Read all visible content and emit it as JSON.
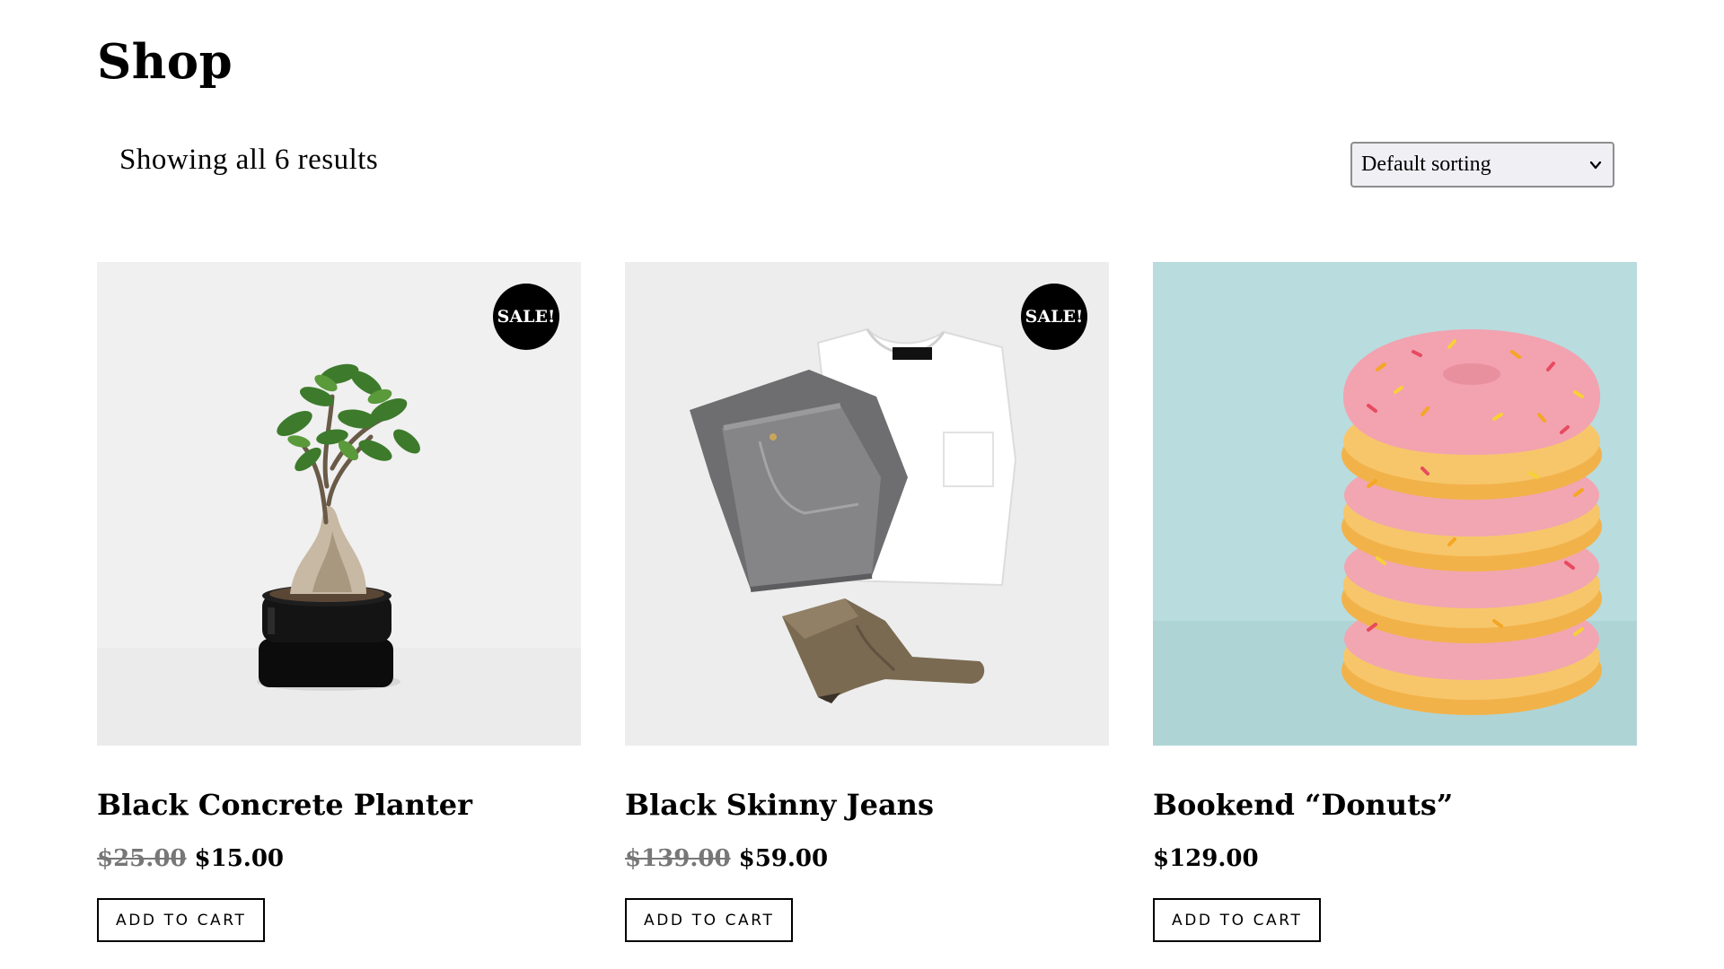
{
  "page": {
    "title": "Shop"
  },
  "toolbar": {
    "result_count": "Showing all 6 results",
    "sorting": {
      "selected": "Default sorting"
    }
  },
  "products": [
    {
      "title": "Black Concrete Planter",
      "old_price": "$25.00",
      "price": "$15.00",
      "badge": "SALE!",
      "button": "ADD TO CART",
      "image": "bonsai-in-black-pot"
    },
    {
      "title": "Black Skinny Jeans",
      "old_price": "$139.00",
      "price": "$59.00",
      "badge": "SALE!",
      "button": "ADD TO CART",
      "image": "jeans-tshirt-boot-flatlay"
    },
    {
      "title": "Bookend “Donuts”",
      "price": "$129.00",
      "button": "ADD TO CART",
      "image": "stacked-pink-donuts"
    }
  ],
  "colors": {
    "accent": "#000000",
    "old_price": "#777777",
    "select_bg": "#efeff4",
    "donut_bg": "#b9dcde"
  }
}
